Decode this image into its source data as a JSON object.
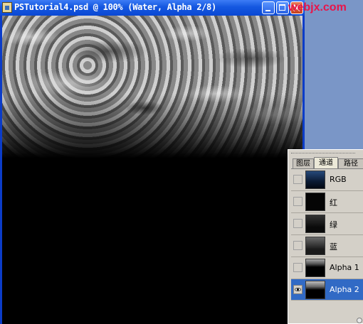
{
  "window": {
    "title": "PSTutorial4.psd @ 100% (Water, Alpha 2/8)",
    "minimize_icon": "minimize-icon",
    "maximize_icon": "maximize-icon",
    "close_icon": "close-icon"
  },
  "watermark": "webjx.com",
  "colors": {
    "titlebar": "#0a48d4",
    "selected_row": "#316ac5",
    "watermark": "#e8154a",
    "panel_bg": "#d4d0c8"
  },
  "panel": {
    "tabs": [
      "图层",
      "通道",
      "路径"
    ],
    "active_tab": "通道",
    "channels": [
      {
        "label": "RGB",
        "visible": false,
        "selected": false
      },
      {
        "label": "红",
        "visible": false,
        "selected": false
      },
      {
        "label": "绿",
        "visible": false,
        "selected": false
      },
      {
        "label": "蓝",
        "visible": false,
        "selected": false
      },
      {
        "label": "Alpha 1",
        "visible": false,
        "selected": false
      },
      {
        "label": "Alpha 2",
        "visible": true,
        "selected": true
      }
    ]
  }
}
